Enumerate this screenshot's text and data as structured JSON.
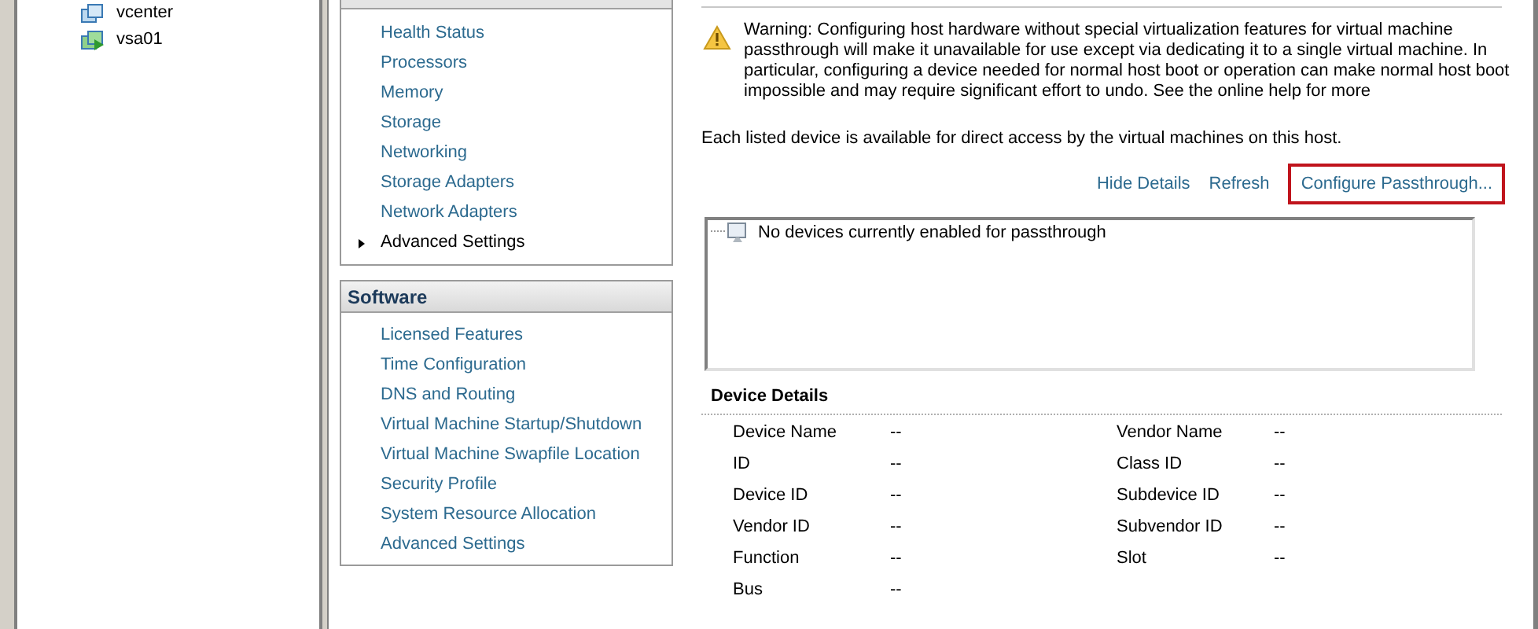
{
  "inventory": {
    "items": [
      {
        "label": "vcenter",
        "kind": "vm",
        "selected": false
      },
      {
        "label": "vsa01",
        "kind": "vm-running",
        "selected": false
      }
    ]
  },
  "hardware": {
    "items": [
      {
        "label": "Health Status",
        "selected": false
      },
      {
        "label": "Processors",
        "selected": false
      },
      {
        "label": "Memory",
        "selected": false
      },
      {
        "label": "Storage",
        "selected": false
      },
      {
        "label": "Networking",
        "selected": false
      },
      {
        "label": "Storage Adapters",
        "selected": false
      },
      {
        "label": "Network Adapters",
        "selected": false
      },
      {
        "label": "Advanced Settings",
        "selected": true
      }
    ]
  },
  "software": {
    "title": "Software",
    "items": [
      {
        "label": "Licensed Features",
        "selected": false
      },
      {
        "label": "Time Configuration",
        "selected": false
      },
      {
        "label": "DNS and Routing",
        "selected": false
      },
      {
        "label": "Virtual Machine Startup/Shutdown",
        "selected": false
      },
      {
        "label": "Virtual Machine Swapfile Location",
        "selected": false
      },
      {
        "label": "Security Profile",
        "selected": false
      },
      {
        "label": "System Resource Allocation",
        "selected": false
      },
      {
        "label": "Advanced Settings",
        "selected": false
      }
    ]
  },
  "warning": "Warning: Configuring host hardware without special virtualization features for virtual machine passthrough will make it unavailable for use except via dedicating it to a single virtual machine. In particular, configuring a device needed for normal host boot or operation can make normal host boot impossible and may require significant effort to undo. See the online help for more",
  "description": "Each listed device is available for direct access by the virtual machines on this host.",
  "actions": [
    {
      "label": "Hide Details",
      "highlighted": false
    },
    {
      "label": "Refresh",
      "highlighted": false
    },
    {
      "label": "Configure Passthrough...",
      "highlighted": true
    }
  ],
  "device_list": {
    "empty_text": "No devices currently enabled for passthrough"
  },
  "device_details": {
    "title": "Device Details",
    "fields": [
      {
        "label": "Device Name",
        "value": "--"
      },
      {
        "label": "Vendor Name",
        "value": "--"
      },
      {
        "label": "ID",
        "value": "--"
      },
      {
        "label": "Class ID",
        "value": "--"
      },
      {
        "label": "Device ID",
        "value": "--"
      },
      {
        "label": "Subdevice ID",
        "value": "--"
      },
      {
        "label": "Vendor ID",
        "value": "--"
      },
      {
        "label": "Subvendor ID",
        "value": "--"
      },
      {
        "label": "Function",
        "value": "--"
      },
      {
        "label": "Slot",
        "value": "--"
      },
      {
        "label": "Bus",
        "value": "--"
      }
    ]
  }
}
